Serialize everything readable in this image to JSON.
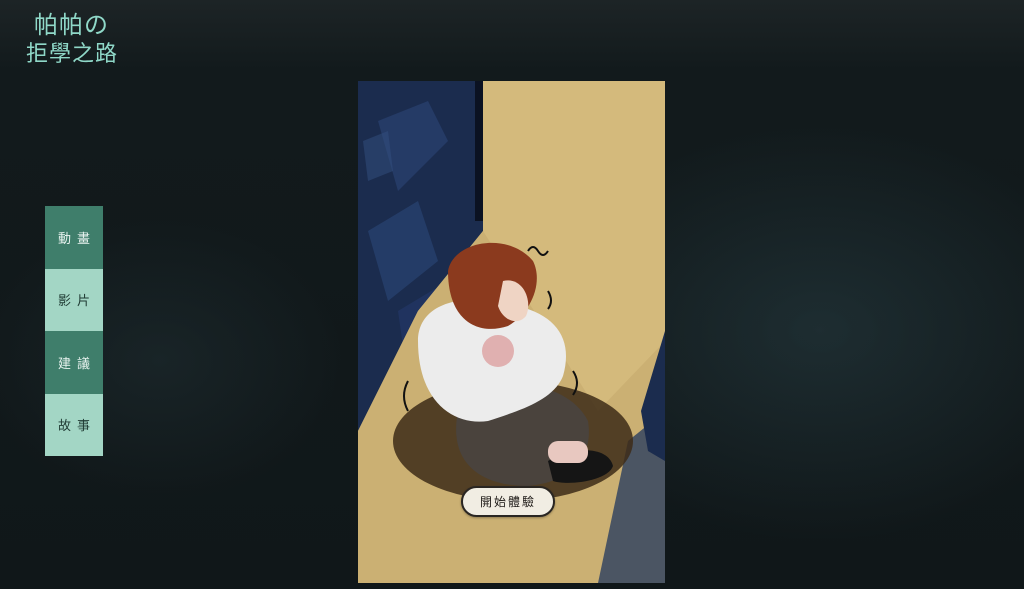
{
  "logo": {
    "line1": "帕帕の",
    "line2": "拒學之路"
  },
  "nav": {
    "items": [
      {
        "label": "動畫"
      },
      {
        "label": "影片"
      },
      {
        "label": "建議"
      },
      {
        "label": "故事"
      }
    ]
  },
  "hero": {
    "start_label": "開始體驗"
  },
  "colors": {
    "logo_text": "#8fd8c8",
    "nav_dark": "#3f7e6b",
    "nav_light": "#a3d6c5",
    "scene_wall": "#1c2d4f",
    "scene_light": "#d4ba7c",
    "background": "#121a1c"
  }
}
